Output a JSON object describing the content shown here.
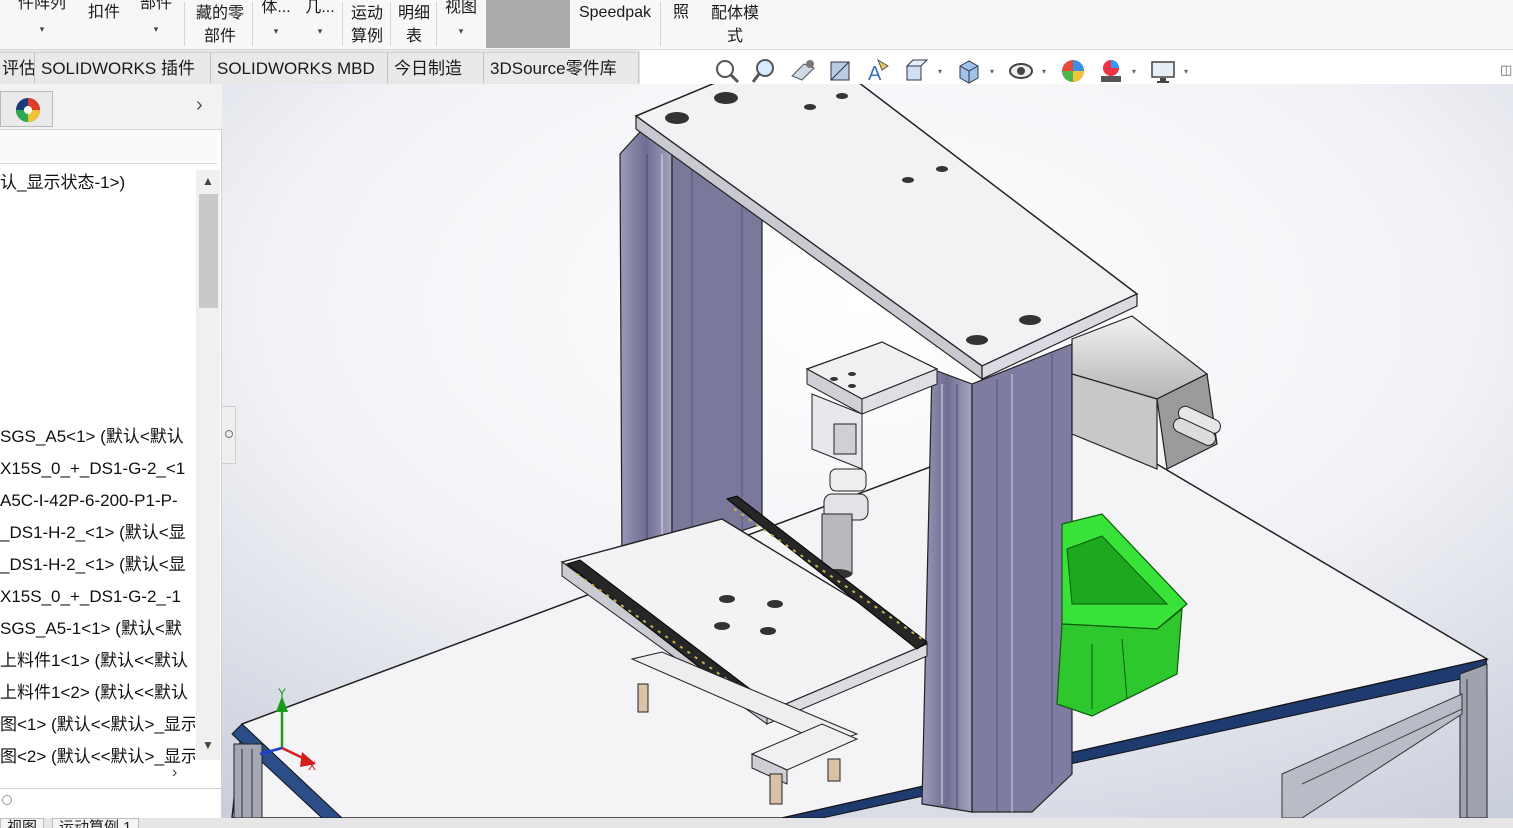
{
  "ribbon": {
    "buttons": [
      {
        "l1": "件阵列",
        "l2": "",
        "caret": "▾"
      },
      {
        "l1": "扣件",
        "l2": "",
        "caret": ""
      },
      {
        "l1": "部件",
        "l2": "",
        "caret": "▾"
      },
      {
        "l1": "藏的零",
        "l2": "部件",
        "caret": ""
      },
      {
        "l1": "体...",
        "l2": "",
        "caret": "▾"
      },
      {
        "l1": "几...",
        "l2": "",
        "caret": "▾"
      },
      {
        "l1": "运动",
        "l2": "算例",
        "caret": ""
      },
      {
        "l1": "明细",
        "l2": "表",
        "caret": ""
      },
      {
        "l1": "视图",
        "l2": "",
        "caret": "▾"
      },
      {
        "l1": "Speedpak",
        "l2": "",
        "caret": ""
      },
      {
        "l1": "照",
        "l2": "",
        "caret": ""
      },
      {
        "l1": "配体模",
        "l2": "式",
        "caret": ""
      }
    ]
  },
  "tabs": [
    "评估",
    "SOLIDWORKS 插件",
    "SOLIDWORKS MBD",
    "今日制造",
    "3DSource零件库"
  ],
  "tree": {
    "root": "认_显示状态-1>)",
    "items": [
      "SGS_A5<1> (默认<默认",
      "X15S_0_+_DS1-G-2_<1",
      "A5C-I-42P-6-200-P1-P-",
      "_DS1-H-2_<1> (默认<显",
      "_DS1-H-2_<1> (默认<显",
      "X15S_0_+_DS1-G-2_-1",
      "SGS_A5-1<1> (默认<默",
      "上料件1<1> (默认<<默认",
      "上料件1<2> (默认<<默认",
      "图<1> (默认<<默认>_显示",
      "图<2> (默认<<默认>_显示"
    ]
  },
  "bottom_tabs": [
    "视图",
    "运动算例 1"
  ],
  "triad": {
    "x": "X",
    "y": "Y"
  },
  "colors": {
    "ribbon_bg": "#f7f7f7",
    "viewport_bg_light": "#ffffff",
    "viewport_bg_dark": "#c9cedb",
    "plate": "#efeff3",
    "column": "#7c7a9c",
    "bin": "#22dd22",
    "rail": "#2a2a2a"
  },
  "hud_icons": [
    "zoom-to-fit-icon",
    "zoom-area-icon",
    "previous-view-icon",
    "section-view-icon",
    "dynamic-annotation-icon",
    "view-orientation-icon",
    "display-style-icon",
    "hide-show-icon",
    "edit-appearance-icon",
    "apply-scene-icon",
    "view-settings-icon"
  ]
}
